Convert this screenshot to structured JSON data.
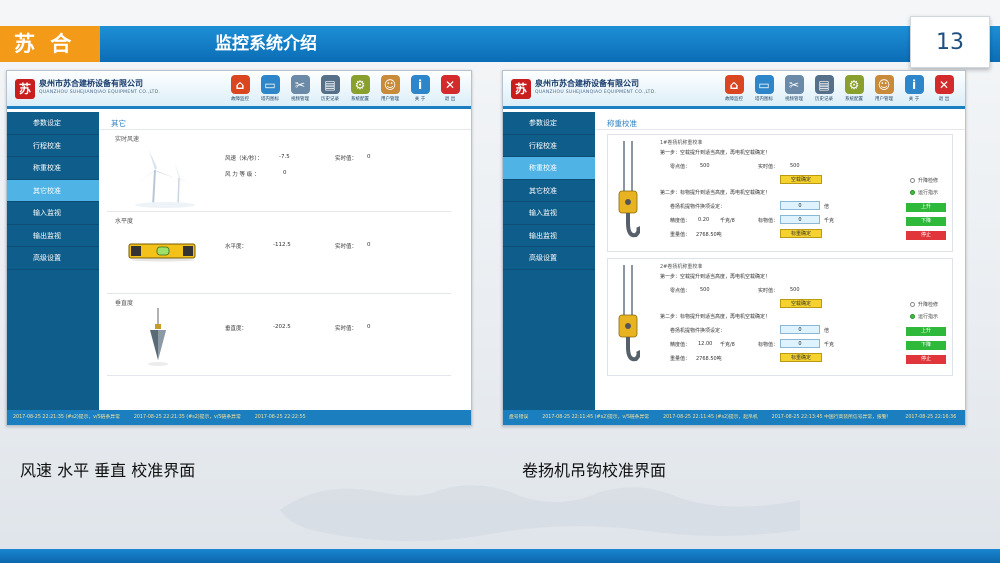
{
  "slide": {
    "brand": "苏 合",
    "title": "监控系统介绍",
    "page_number": "13"
  },
  "app": {
    "company_name": "泉州市苏合建桥设备有限公司",
    "company_en": "QUANZHOU SUHEJIANQIAO EQUIPMENT CO.,LTD.",
    "logo_char": "苏",
    "toolbar": [
      {
        "icon": "home-icon",
        "label": "故障监控",
        "color": "#d9461f",
        "glyph": "⌂"
      },
      {
        "icon": "monitor-icon",
        "label": "塔内图标",
        "color": "#2c86c9",
        "glyph": "▭"
      },
      {
        "icon": "tools-icon",
        "label": "视频管理",
        "color": "#6a8aa8",
        "glyph": "✂"
      },
      {
        "icon": "records-icon",
        "label": "历史记录",
        "color": "#567089",
        "glyph": "▤"
      },
      {
        "icon": "settings-icon",
        "label": "系统配置",
        "color": "#8aa02e",
        "glyph": "⚙"
      },
      {
        "icon": "user-icon",
        "label": "用户管理",
        "color": "#c98a3a",
        "glyph": "☺"
      },
      {
        "icon": "info-icon",
        "label": "关 于",
        "color": "#2c86c9",
        "glyph": "i"
      },
      {
        "icon": "exit-icon",
        "label": "退 出",
        "color": "#d32b2b",
        "glyph": "✕"
      }
    ]
  },
  "left_panel": {
    "sidebar": [
      "参数设定",
      "行程校准",
      "称重校准",
      "其它校准",
      "输入监视",
      "输出监视",
      "高级设置"
    ],
    "active_index": 3,
    "section_title": "其它",
    "wind": {
      "label": "实时风速",
      "speed_label": "风速（米/秒）：",
      "speed_value": "-7.5",
      "realtime_label": "实时值：",
      "realtime_value": "0",
      "level_label": "风 力 等 级 ：",
      "level_value": "0"
    },
    "level": {
      "label": "水平度",
      "value_label": "水平度：",
      "value": "-112.5",
      "realtime_label": "实时值：",
      "realtime_value": "0"
    },
    "vertical": {
      "label": "垂直度",
      "value_label": "垂直度：",
      "value": "-202.5",
      "realtime_label": "实时值：",
      "realtime_value": "0"
    },
    "status": [
      "2017-08-25 22:21:35 (#s2)提示，v/S链条异常",
      "2017-08-25 22:21:35 (#s2)提示，v/S链条异常",
      "2017-08-25 22:22:55"
    ]
  },
  "right_panel": {
    "sidebar": [
      "参数设定",
      "行程校准",
      "称重校准",
      "其它校准",
      "输入监视",
      "输出监视",
      "高级设置"
    ],
    "active_index": 2,
    "section_title": "称重校准",
    "hooks": [
      {
        "title": "1#卷扬机称重校准",
        "step1": "第一步：空载提升到适当高度，再电机空载确定！",
        "zero_label": "零点值：",
        "zero_value": "500",
        "realtime_label": "实时值：",
        "realtime_value": "500",
        "empty_btn": "空载确定",
        "step2": "第二步：标物提升到适当高度，再电机空载确定！",
        "weight_setting_label": "卷扬机提物件换项设定：",
        "weight_setting_value": "0",
        "weight_unit": "倍",
        "precision_label": "精度值：",
        "precision_value": "0.20",
        "precision_unit": "千克/8",
        "target_label": "标物值：",
        "target_value": "0",
        "target_unit": "千克",
        "weigh_label": "重量值：",
        "weigh_value": "2768.50吨",
        "weight_btn": "标重确定",
        "radio_1": "升降检修",
        "radio_2": "运行指示",
        "btn_up": "上升",
        "btn_down": "下降",
        "btn_stop": "停止"
      },
      {
        "title": "2#卷扬机称重校准",
        "step1": "第一步：空载提升到适当高度，再电机空载确定！",
        "zero_label": "零点值：",
        "zero_value": "500",
        "realtime_label": "实时值：",
        "realtime_value": "500",
        "empty_btn": "空载确定",
        "step2": "第二步：标物提升到适当高度，再电机空载确定！",
        "weight_setting_label": "卷扬机提物件换项设定：",
        "weight_setting_value": "0",
        "weight_unit": "倍",
        "precision_label": "精度值：",
        "precision_value": "12.00",
        "precision_unit": "千克/8",
        "target_label": "标物值：",
        "target_value": "0",
        "target_unit": "千克",
        "weigh_label": "重量值：",
        "weigh_value": "2768.50吨",
        "weight_btn": "标重确定",
        "radio_1": "升降检修",
        "radio_2": "运行指示",
        "btn_up": "上升",
        "btn_down": "下降",
        "btn_stop": "停止"
      }
    ],
    "status": [
      "盘号错误",
      "2017-08-25 22:11:45 (#s2)提示，v/S链条异常",
      "2017-08-25 22:11:45 (#s2)提示，起吊机",
      "2017-08-25 22:13:45 中国行高装所信号异常，报警！",
      "2017-08-25 22:16:36"
    ]
  },
  "captions": {
    "left": "风速  水平  垂直  校准界面",
    "right": "卷扬机吊钩校准界面"
  }
}
